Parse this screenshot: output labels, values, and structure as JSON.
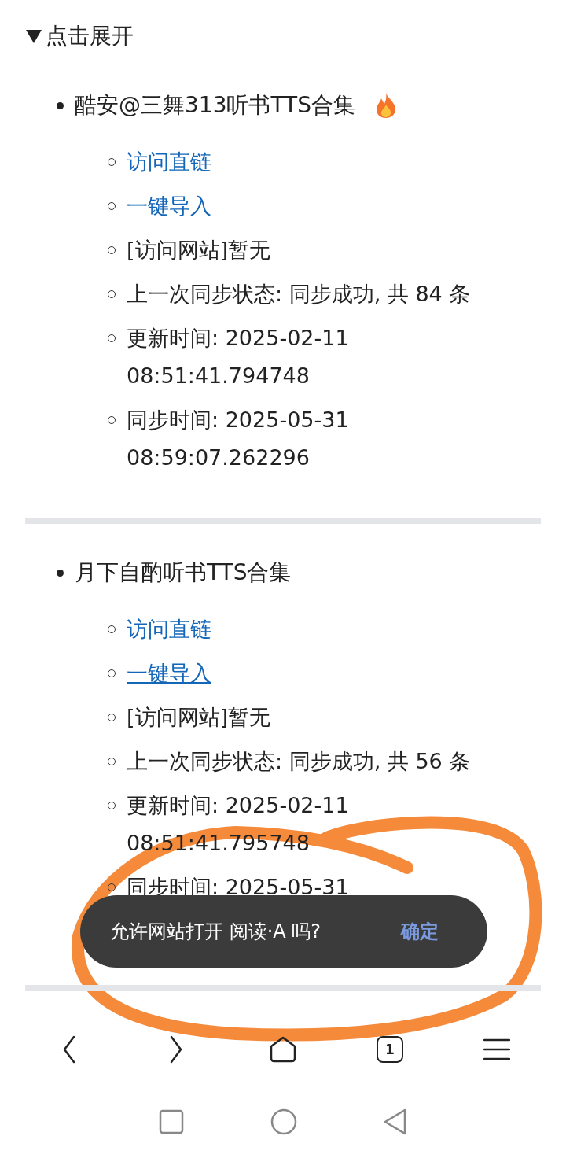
{
  "details": {
    "summary": "点击展开",
    "expanded": true
  },
  "sections": [
    {
      "title": "酷安@三舞313听书TTS合集",
      "hot": true,
      "items": [
        {
          "kind": "link",
          "text": "访问直链",
          "focused": false
        },
        {
          "kind": "link",
          "text": "一键导入",
          "focused": false
        },
        {
          "kind": "text",
          "text": "[访问网站]暂无"
        },
        {
          "kind": "text",
          "text": "上一次同步状态: 同步成功, 共 84 条"
        },
        {
          "kind": "timestamp",
          "text": "更新时间: 2025-02-11 08:51:41.794748"
        },
        {
          "kind": "timestamp",
          "text": "同步时间: 2025-05-31 08:59:07.262296"
        }
      ]
    },
    {
      "title": "月下自酌听书TTS合集",
      "hot": false,
      "items": [
        {
          "kind": "link",
          "text": "访问直链",
          "focused": false
        },
        {
          "kind": "link",
          "text": "一键导入",
          "focused": true
        },
        {
          "kind": "text",
          "text": "[访问网站]暂无"
        },
        {
          "kind": "text",
          "text": "上一次同步状态: 同步成功, 共 56 条"
        },
        {
          "kind": "timestamp",
          "text": "更新时间: 2025-02-11 08:51:41.795748"
        },
        {
          "kind": "timestamp",
          "text": "同步时间: 2025-05-31"
        }
      ]
    }
  ],
  "toast": {
    "message": "允许网站打开 阅读·A 吗?",
    "action": "确定"
  },
  "annotation": {
    "kind": "circle"
  },
  "toolbar": {
    "tab_count": "1"
  }
}
